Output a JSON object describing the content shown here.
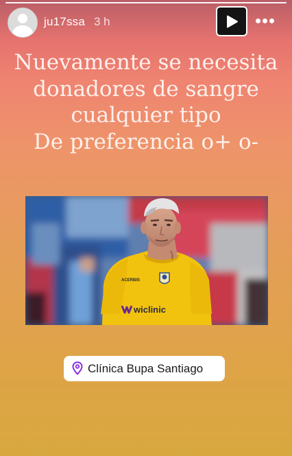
{
  "story": {
    "username": "ju17ssa",
    "timestamp": "3 h",
    "progress": 1.0,
    "headline": "Nuevamente se necesita\ndonadores de sangre\ncualquier tipo\nDe preferencia o+ o-",
    "photo": {
      "description_icon": "goalkeeper-photo",
      "jersey_text": "wiclinic",
      "brand_text": "ACERBIS"
    },
    "location": {
      "icon": "location-pin-icon",
      "label": "Clínica Bupa Santiago"
    }
  },
  "controls": {
    "play_icon": "play-icon",
    "more_icon": "more-options-icon"
  },
  "colors": {
    "gradient_top": "#b95e67",
    "gradient_mid": "#ee946a",
    "gradient_bottom": "#d8a83f",
    "location_pin": "#8a2be2",
    "jersey": "#f2c30e"
  }
}
